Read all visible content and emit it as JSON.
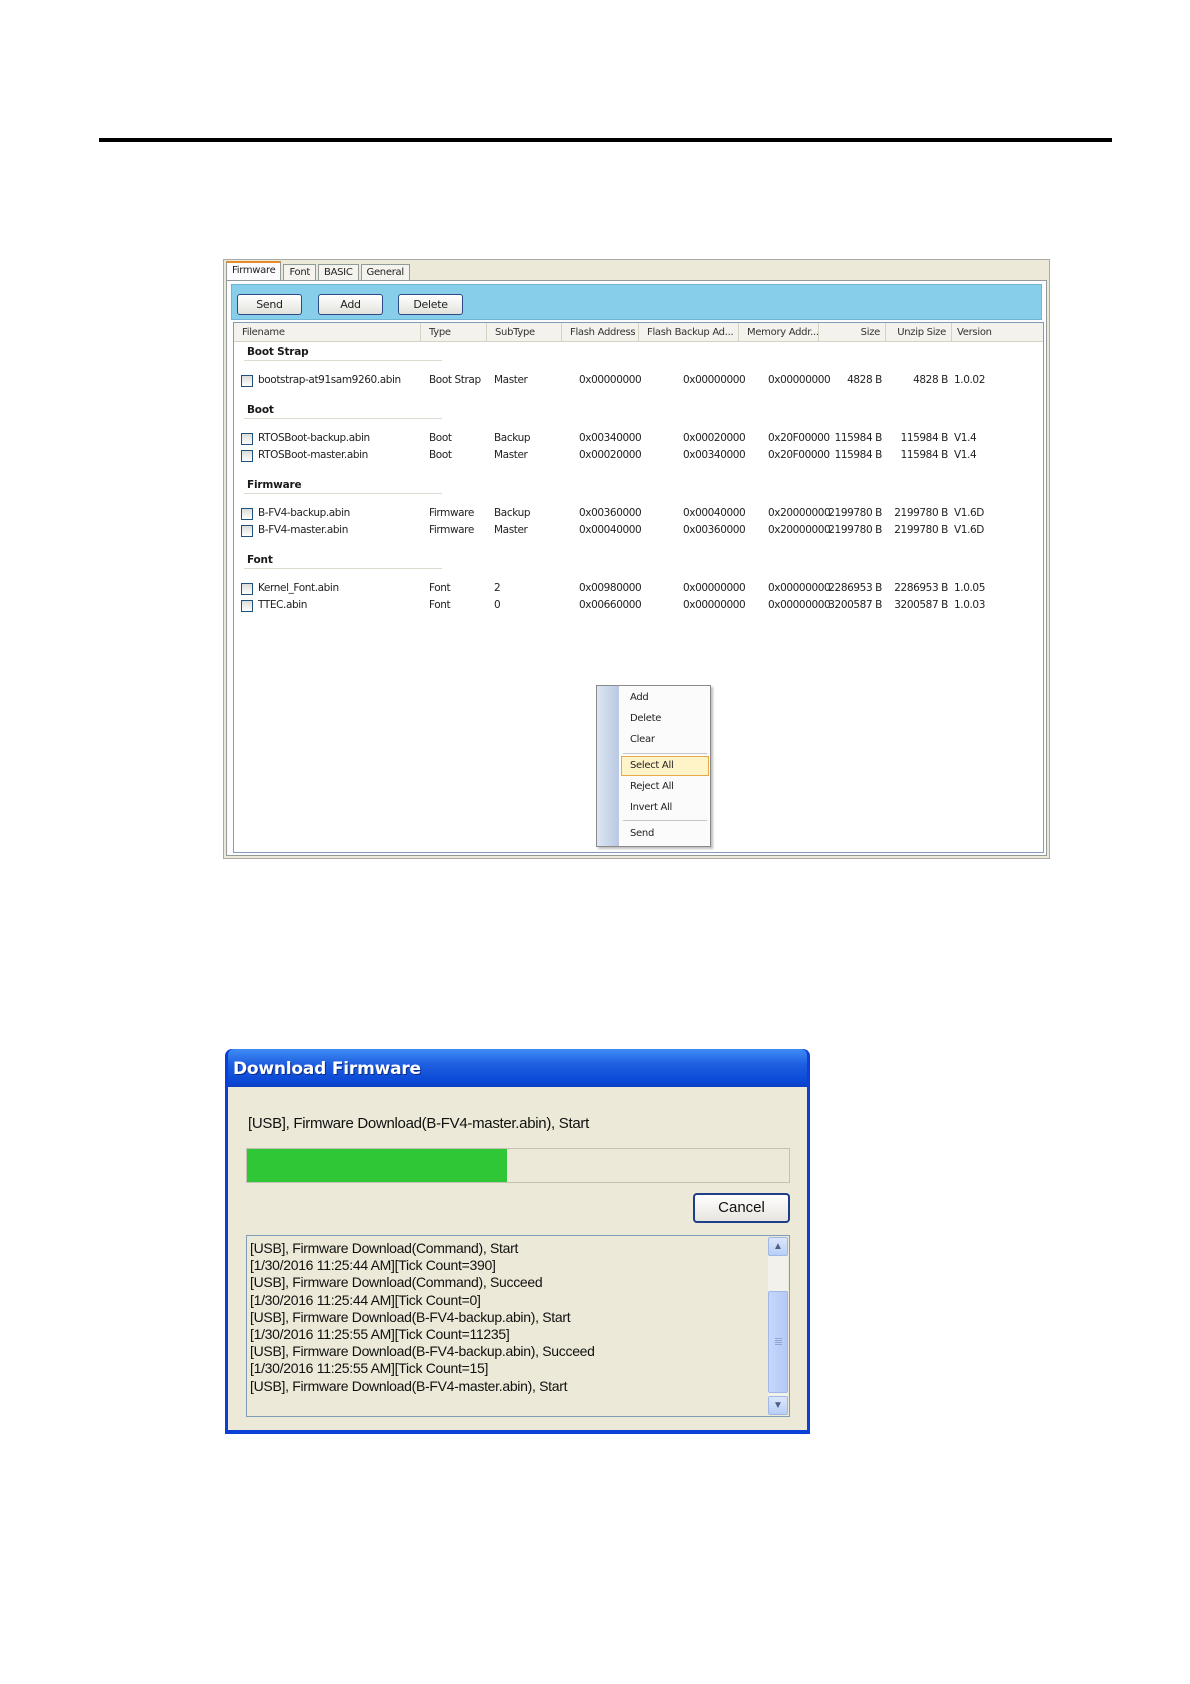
{
  "firmware_window": {
    "tabs": [
      "Firmware",
      "Font",
      "BASIC",
      "General"
    ],
    "toolbar": {
      "send": "Send",
      "add": "Add",
      "delete": "Delete"
    },
    "columns": [
      "Filename",
      "Type",
      "SubType",
      "Flash Address",
      "Flash Backup Ad...",
      "Memory Addr...",
      "Size",
      "Unzip Size",
      "Version"
    ],
    "groups": [
      {
        "title": "Boot Strap",
        "rows": [
          {
            "filename": "bootstrap-at91sam9260.abin",
            "type": "Boot Strap",
            "subtype": "Master",
            "flash": "0x00000000",
            "backup": "0x00000000",
            "memory": "0x00000000",
            "size": "4828 B",
            "unzip": "4828 B",
            "version": "1.0.02"
          }
        ]
      },
      {
        "title": "Boot",
        "rows": [
          {
            "filename": "RTOSBoot-backup.abin",
            "type": "Boot",
            "subtype": "Backup",
            "flash": "0x00340000",
            "backup": "0x00020000",
            "memory": "0x20F00000",
            "size": "115984 B",
            "unzip": "115984 B",
            "version": "V1.4"
          },
          {
            "filename": "RTOSBoot-master.abin",
            "type": "Boot",
            "subtype": "Master",
            "flash": "0x00020000",
            "backup": "0x00340000",
            "memory": "0x20F00000",
            "size": "115984 B",
            "unzip": "115984 B",
            "version": "V1.4"
          }
        ]
      },
      {
        "title": "Firmware",
        "rows": [
          {
            "filename": "B-FV4-backup.abin",
            "type": "Firmware",
            "subtype": "Backup",
            "flash": "0x00360000",
            "backup": "0x00040000",
            "memory": "0x20000000",
            "size": "2199780 B",
            "unzip": "2199780 B",
            "version": "V1.6D"
          },
          {
            "filename": "B-FV4-master.abin",
            "type": "Firmware",
            "subtype": "Master",
            "flash": "0x00040000",
            "backup": "0x00360000",
            "memory": "0x20000000",
            "size": "2199780 B",
            "unzip": "2199780 B",
            "version": "V1.6D"
          }
        ]
      },
      {
        "title": "Font",
        "rows": [
          {
            "filename": "Kernel_Font.abin",
            "type": "Font",
            "subtype": "2",
            "flash": "0x00980000",
            "backup": "0x00000000",
            "memory": "0x00000000",
            "size": "2286953 B",
            "unzip": "2286953 B",
            "version": "1.0.05"
          },
          {
            "filename": "TTEC.abin",
            "type": "Font",
            "subtype": "0",
            "flash": "0x00660000",
            "backup": "0x00000000",
            "memory": "0x00000000",
            "size": "3200587 B",
            "unzip": "3200587 B",
            "version": "1.0.03"
          }
        ]
      }
    ],
    "context_menu": [
      "Add",
      "Delete",
      "Clear",
      "Select All",
      "Reject All",
      "Invert All",
      "Send"
    ],
    "context_menu_highlighted": "Select All"
  },
  "download_dialog": {
    "title": "Download Firmware",
    "status": "[USB], Firmware Download(B-FV4-master.abin), Start",
    "progress_fraction": 0.48,
    "progress_color": "#2fc736",
    "cancel": "Cancel",
    "log": [
      "[USB], Firmware Download(Command), Start",
      "[1/30/2016 11:25:44 AM][Tick Count=390]",
      "[USB], Firmware Download(Command), Succeed",
      "[1/30/2016 11:25:44 AM][Tick Count=0]",
      "[USB], Firmware Download(B-FV4-backup.abin), Start",
      "[1/30/2016 11:25:55 AM][Tick Count=11235]",
      "[USB], Firmware Download(B-FV4-backup.abin), Succeed",
      "[1/30/2016 11:25:55 AM][Tick Count=15]",
      "[USB], Firmware Download(B-FV4-master.abin), Start"
    ]
  }
}
